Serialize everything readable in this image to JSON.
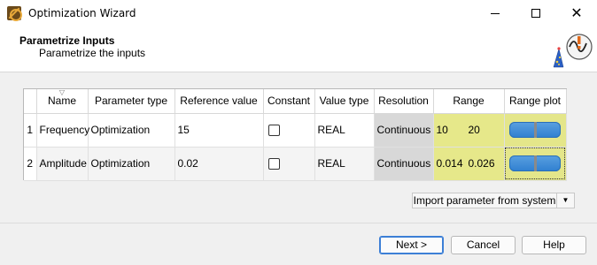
{
  "window": {
    "title": "Optimization Wizard",
    "minimize_glyph": "",
    "maximize_glyph": "",
    "close_glyph": "✕"
  },
  "header": {
    "title": "Parametrize Inputs",
    "subtitle": "Parametrize the inputs"
  },
  "table": {
    "columns": [
      "Name",
      "Parameter type",
      "Reference value",
      "Constant",
      "Value type",
      "Resolution",
      "Range",
      "Range plot"
    ],
    "sort_indicator": "▽",
    "rows": [
      {
        "index": "1",
        "name": "Frequency",
        "parameter_type": "Optimization",
        "reference_value": "15",
        "constant": false,
        "value_type": "REAL",
        "resolution": "Continuous",
        "range_min": "10",
        "range_max": "20"
      },
      {
        "index": "2",
        "name": "Amplitude",
        "parameter_type": "Optimization",
        "reference_value": "0.02",
        "constant": false,
        "value_type": "REAL",
        "resolution": "Continuous",
        "range_min": "0.014",
        "range_max": "0.026"
      }
    ]
  },
  "import": {
    "label": "Import parameter from system",
    "dropdown_glyph": "▼"
  },
  "buttons": {
    "next": "Next >",
    "cancel": "Cancel",
    "help": "Help"
  },
  "colors": {
    "range_cell": "#e6e88a",
    "resolution_cell": "#d8d8d8",
    "slider": "#2f7fd0",
    "default_button_border": "#3c7fd6"
  }
}
